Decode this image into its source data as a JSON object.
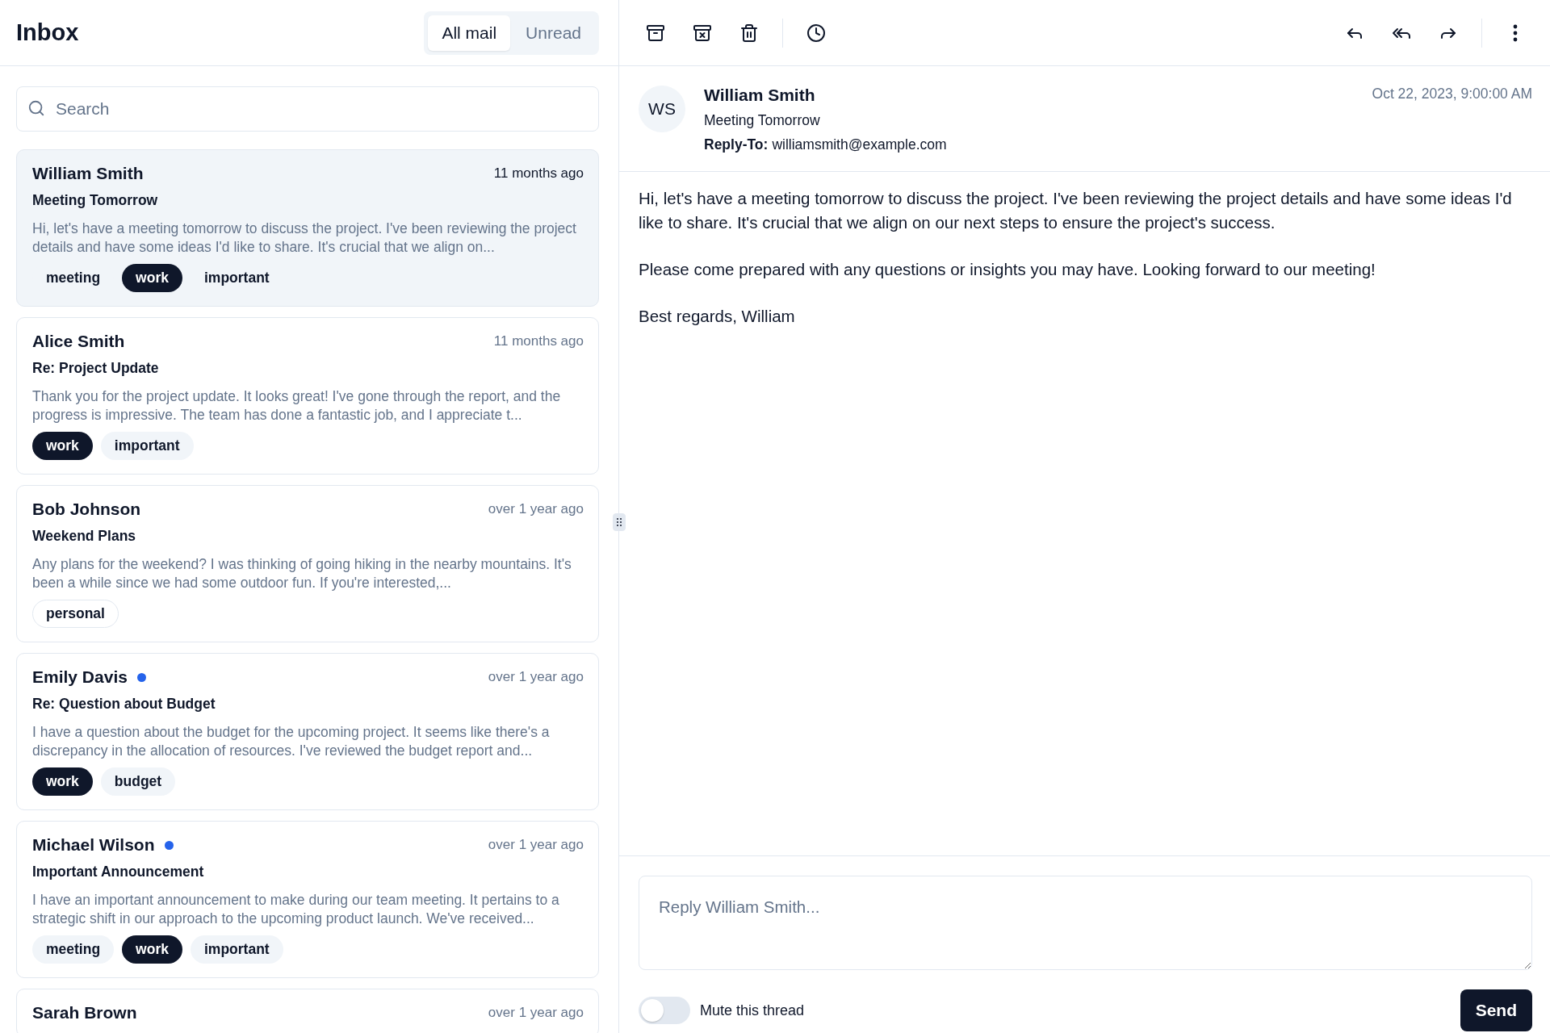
{
  "header": {
    "title": "Inbox",
    "tabs": [
      {
        "label": "All mail",
        "selected": true
      },
      {
        "label": "Unread",
        "selected": false
      }
    ]
  },
  "search": {
    "placeholder": "Search"
  },
  "mails": [
    {
      "name": "William Smith",
      "unread": false,
      "selected": true,
      "time": "11 months ago",
      "subject": "Meeting Tomorrow",
      "preview": "Hi, let's have a meeting tomorrow to discuss the project. I've been reviewing the project details and have some ideas I'd like to share. It's crucial that we align on...",
      "tags": [
        {
          "label": "meeting",
          "kind": "secondary"
        },
        {
          "label": "work",
          "kind": "primary"
        },
        {
          "label": "important",
          "kind": "secondary"
        }
      ]
    },
    {
      "name": "Alice Smith",
      "unread": false,
      "selected": false,
      "time": "11 months ago",
      "subject": "Re: Project Update",
      "preview": "Thank you for the project update. It looks great! I've gone through the report, and the progress is impressive. The team has done a fantastic job, and I appreciate t...",
      "tags": [
        {
          "label": "work",
          "kind": "primary"
        },
        {
          "label": "important",
          "kind": "secondary"
        }
      ]
    },
    {
      "name": "Bob Johnson",
      "unread": false,
      "selected": false,
      "time": "over 1 year ago",
      "subject": "Weekend Plans",
      "preview": "Any plans for the weekend? I was thinking of going hiking in the nearby mountains. It's been a while since we had some outdoor fun. If you're interested,...",
      "tags": [
        {
          "label": "personal",
          "kind": "outline"
        }
      ]
    },
    {
      "name": "Emily Davis",
      "unread": true,
      "selected": false,
      "time": "over 1 year ago",
      "subject": "Re: Question about Budget",
      "preview": "I have a question about the budget for the upcoming project. It seems like there's a discrepancy in the allocation of resources. I've reviewed the budget report and...",
      "tags": [
        {
          "label": "work",
          "kind": "primary"
        },
        {
          "label": "budget",
          "kind": "secondary"
        }
      ]
    },
    {
      "name": "Michael Wilson",
      "unread": true,
      "selected": false,
      "time": "over 1 year ago",
      "subject": "Important Announcement",
      "preview": "I have an important announcement to make during our team meeting. It pertains to a strategic shift in our approach to the upcoming product launch. We've received...",
      "tags": [
        {
          "label": "meeting",
          "kind": "secondary"
        },
        {
          "label": "work",
          "kind": "primary"
        },
        {
          "label": "important",
          "kind": "secondary"
        }
      ]
    },
    {
      "name": "Sarah Brown",
      "unread": false,
      "selected": false,
      "time": "over 1 year ago"
    }
  ],
  "reader": {
    "avatar": "WS",
    "from": "William Smith",
    "subject": "Meeting Tomorrow",
    "reply_to_label": "Reply-To:",
    "reply_to": "williamsmith@example.com",
    "date": "Oct 22, 2023, 9:00:00 AM",
    "body": [
      "Hi, let's have a meeting tomorrow to discuss the project. I've been reviewing the project details and have some ideas I'd like to share. It's crucial that we align on our next steps to ensure the project's success.",
      "Please come prepared with any questions or insights you may have. Looking forward to our meeting!",
      "Best regards, William"
    ],
    "reply": {
      "placeholder": "Reply William Smith..."
    },
    "mute": {
      "label": "Mute this thread",
      "on": false
    },
    "send": "Send"
  }
}
